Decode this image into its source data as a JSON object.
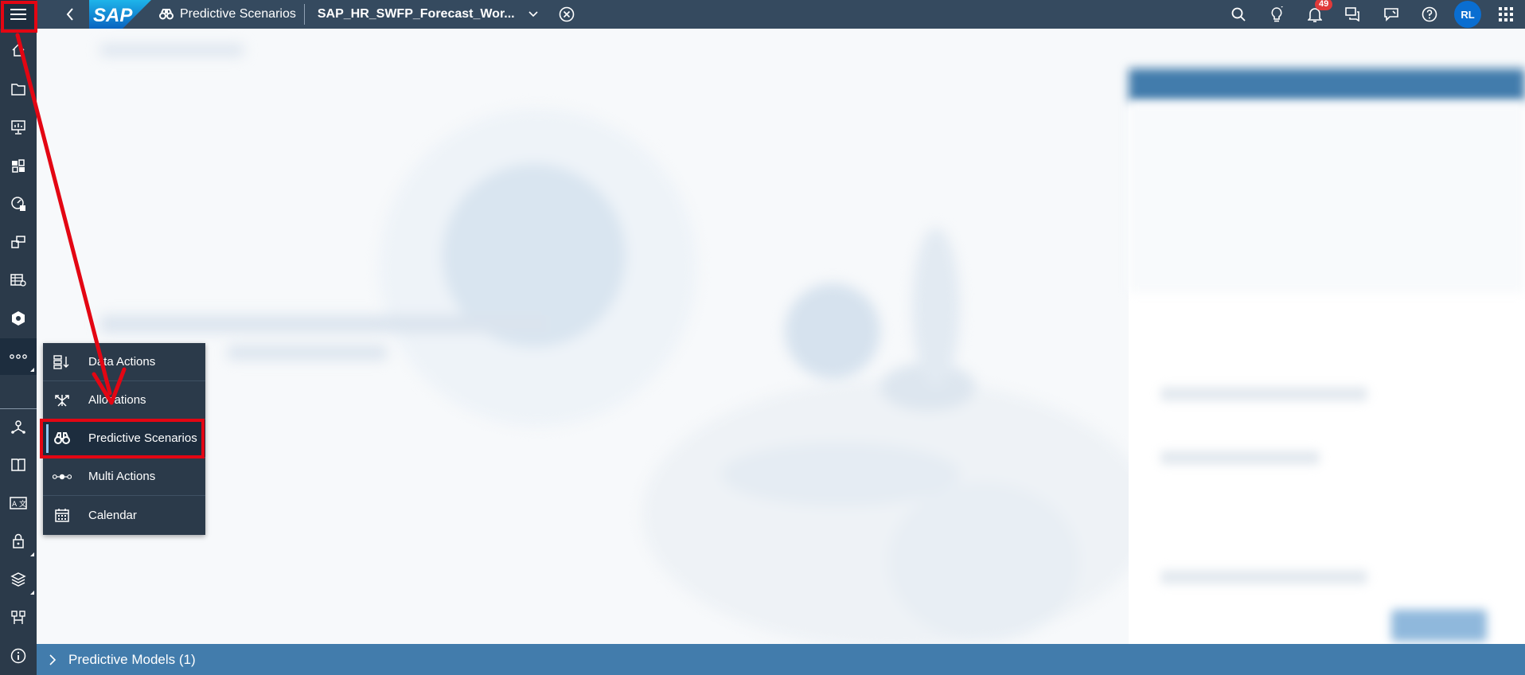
{
  "shell": {
    "app_title": "Predictive Scenarios",
    "doc_title": "SAP_HR_SWFP_Forecast_Wor...",
    "notification_count": "49",
    "user_initials": "RL",
    "colors": {
      "shell_bg": "#354a5f",
      "nav_bg": "#2b3a4a",
      "avatar": "#0a6ed1",
      "badge": "#e03a3a"
    }
  },
  "nav": {
    "icons": [
      "home-icon",
      "folder-icon",
      "stories-icon",
      "analytic-app-icon",
      "digital-boardroom-icon",
      "data-analyzer-icon",
      "modeler-icon",
      "data-marketplace-icon",
      "more-icon",
      "connections-icon",
      "catalog-icon",
      "translation-icon",
      "security-icon",
      "system-icon",
      "deployment-icon",
      "info-icon"
    ]
  },
  "popup_menu": {
    "items": [
      {
        "label": "Data Actions",
        "icon": "data-actions-icon"
      },
      {
        "label": "Allocations",
        "icon": "allocations-icon"
      },
      {
        "label": "Predictive Scenarios",
        "icon": "binoculars-icon"
      },
      {
        "label": "Multi Actions",
        "icon": "multi-actions-icon"
      },
      {
        "label": "Calendar",
        "icon": "calendar-icon"
      }
    ],
    "selected": "Predictive Scenarios"
  },
  "bottom_bar": {
    "label": "Predictive Models (1)",
    "color": "#427cac"
  },
  "annotations": {
    "highlight_color": "#e30613"
  }
}
